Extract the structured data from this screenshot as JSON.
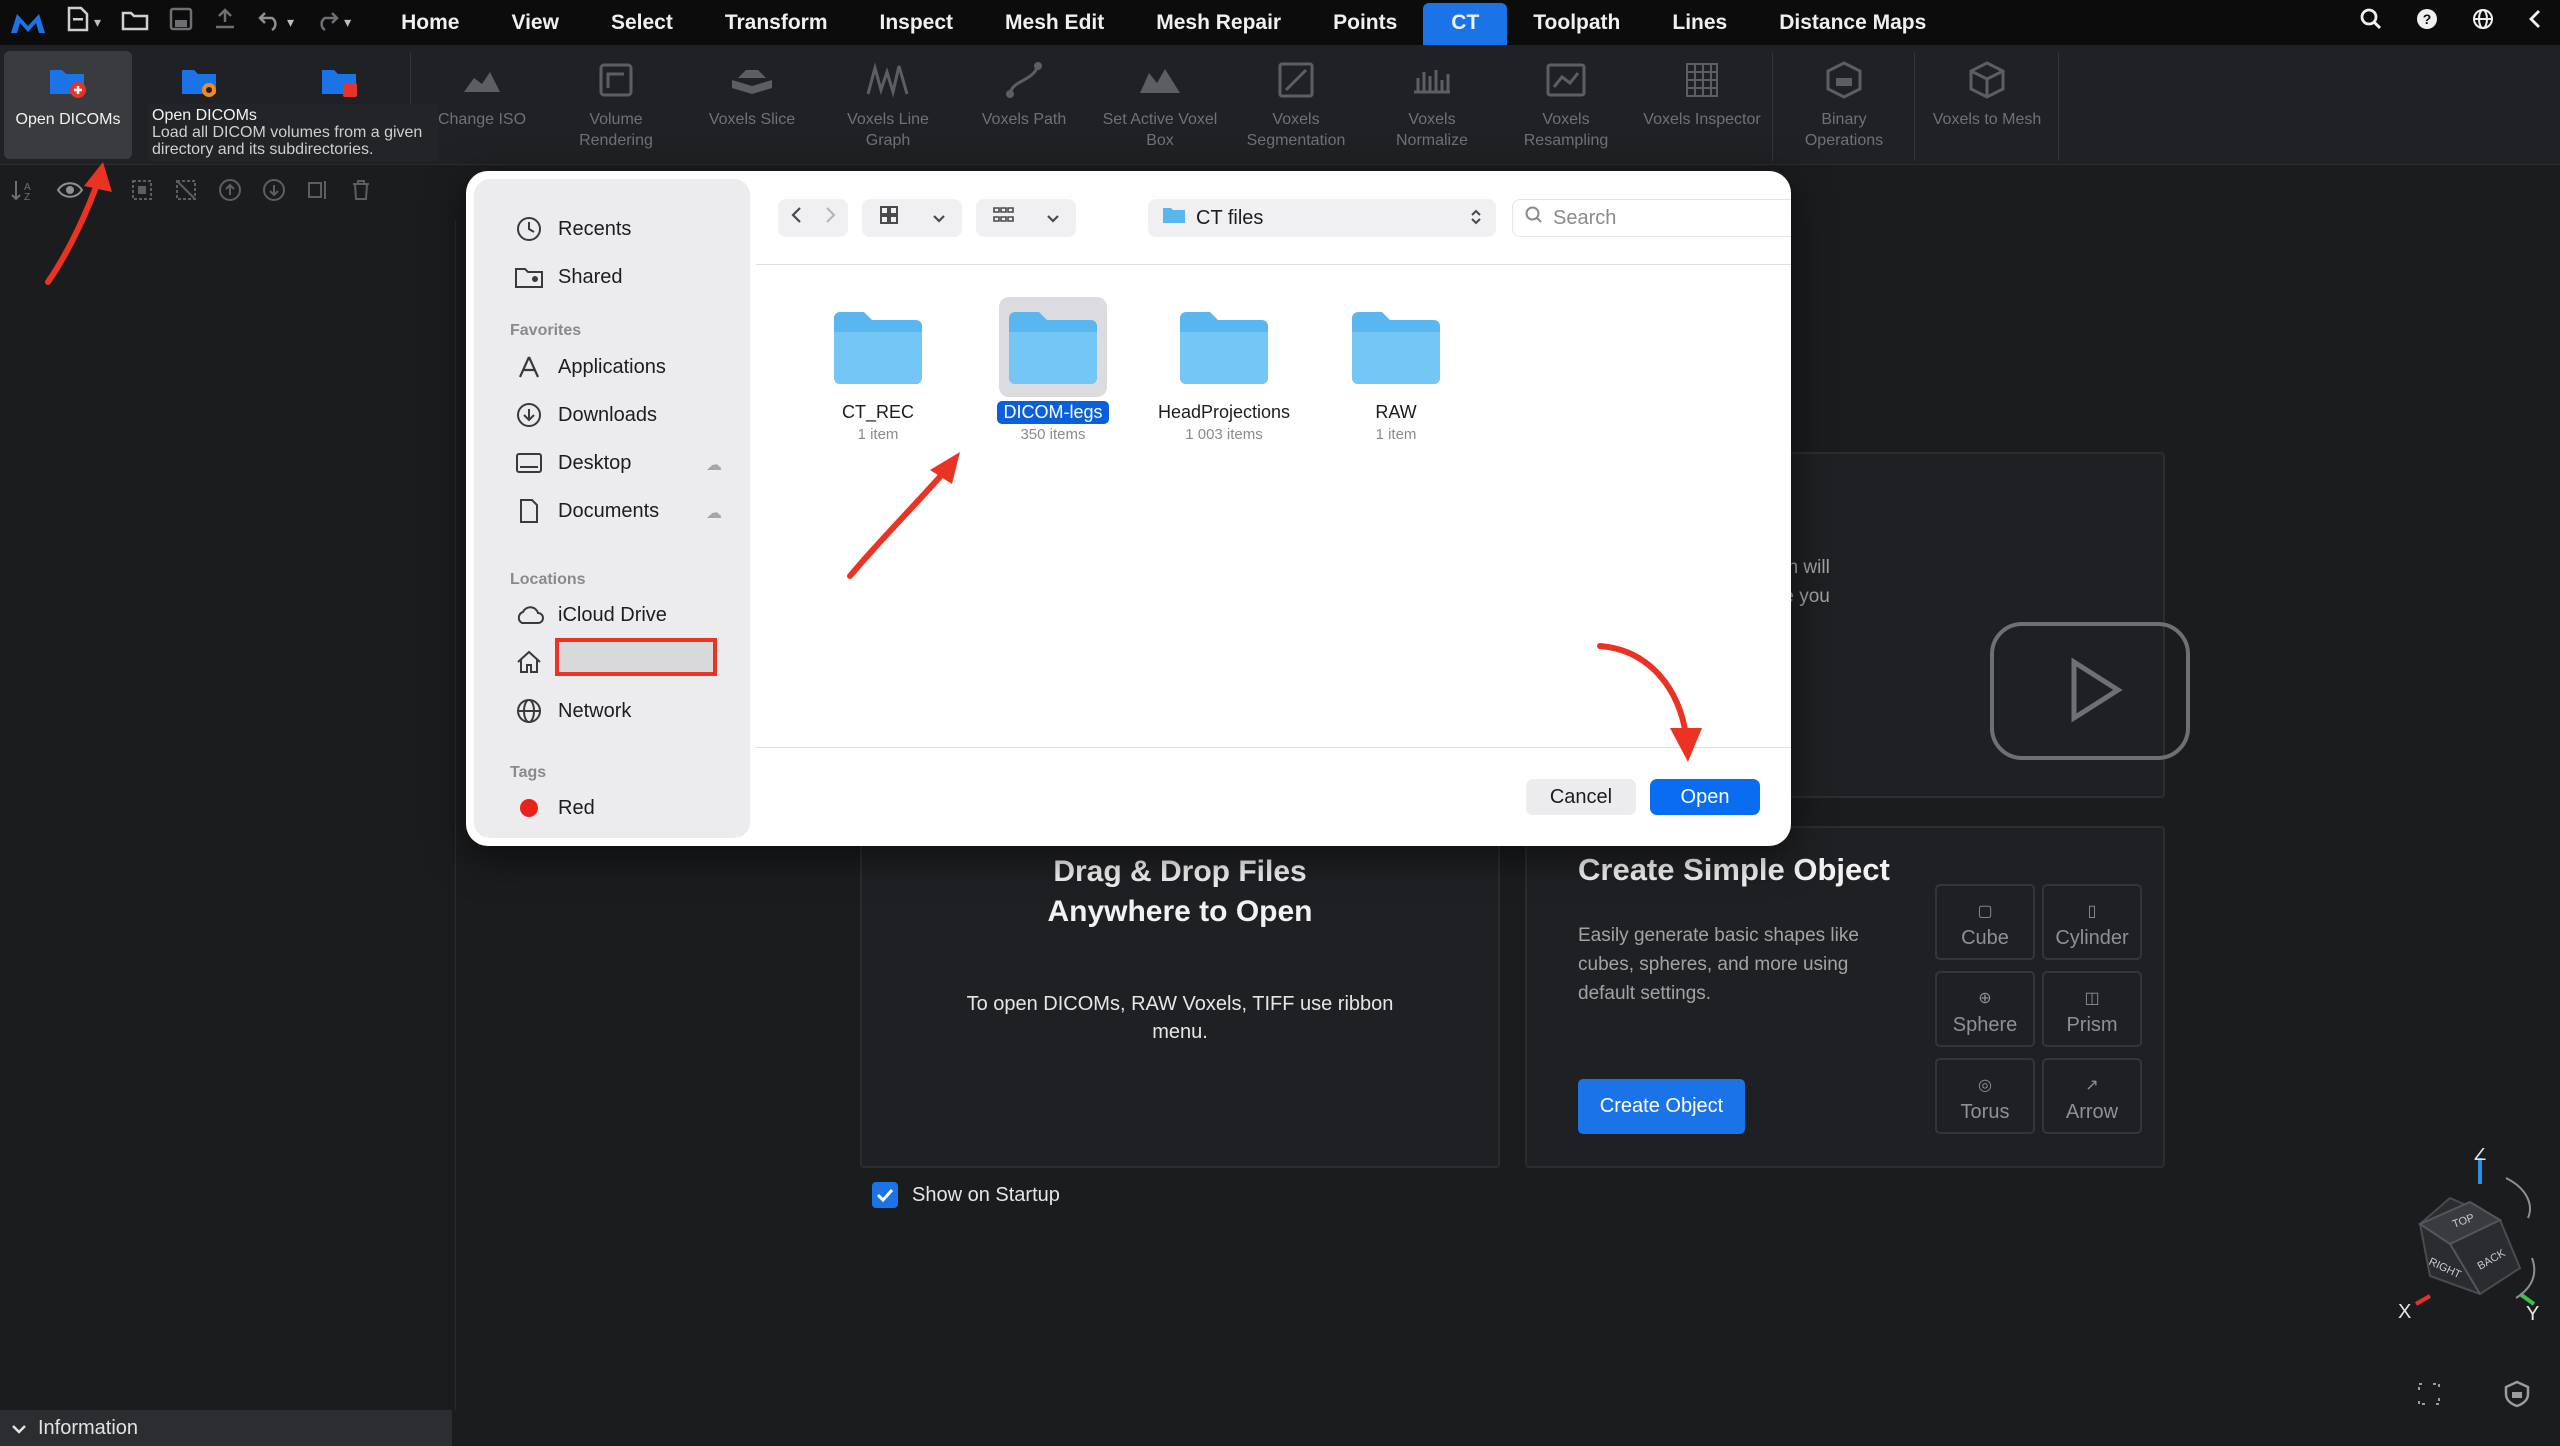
{
  "menubar": {
    "tabs": [
      "Home",
      "View",
      "Select",
      "Transform",
      "Inspect",
      "Mesh Edit",
      "Mesh Repair",
      "Points",
      "CT",
      "Toolpath",
      "Lines",
      "Distance Maps"
    ],
    "active_tab": "CT",
    "accent": "#1a74e8"
  },
  "ribbon": {
    "open_dicoms": "Open DICOMs",
    "change_iso": "Change ISO",
    "volume_rendering": "Volume Rendering",
    "voxels_slice": "Voxels Slice",
    "voxels_line_graph": "Voxels Line Graph",
    "voxels_path": "Voxels Path",
    "set_active_voxel_box": "Set Active Voxel Box",
    "voxels_segmentation": "Voxels Segmentation",
    "voxels_normalize": "Voxels Normalize",
    "voxels_resampling": "Voxels Resampling",
    "voxels_inspector": "Voxels Inspector",
    "binary_operations": "Binary Operations",
    "voxels_to_mesh": "Voxels to Mesh"
  },
  "tooltip": {
    "title": "Open DICOMs",
    "body": "Load all DICOM volumes from a given directory and its subdirectories."
  },
  "left_panel": {
    "information": "Information"
  },
  "start_page": {
    "video_text_1": "ction will",
    "video_text_2": "uide you",
    "dnd_title_1": "Drag & Drop Files",
    "dnd_title_2": "Anywhere to Open",
    "dnd_sub": "To open DICOMs, RAW Voxels, TIFF use ribbon menu.",
    "simple_title": "Create Simple Object",
    "simple_desc": "Easily generate basic shapes like cubes, spheres, and more using default settings.",
    "create_button": "Create Object",
    "shapes": [
      "Cube",
      "Cylinder",
      "Sphere",
      "Prism",
      "Torus",
      "Arrow"
    ],
    "show_on_startup": "Show on Startup",
    "show_on_startup_checked": true
  },
  "viewcube": {
    "axes": {
      "z": "Z",
      "x": "X",
      "y": "Y"
    },
    "faces": {
      "top": "TOP",
      "right": "RIGHT",
      "back": "BACK"
    }
  },
  "dialog": {
    "sidebar": {
      "recents": "Recents",
      "shared": "Shared",
      "favorites_header": "Favorites",
      "applications": "Applications",
      "downloads": "Downloads",
      "desktop": "Desktop",
      "documents": "Documents",
      "locations_header": "Locations",
      "icloud": "iCloud Drive",
      "network": "Network",
      "tags_header": "Tags",
      "tag_red": "Red",
      "tag_red_color": "#e8241a"
    },
    "path": "CT files",
    "search_placeholder": "Search",
    "folders": [
      {
        "name": "CT_REC",
        "count": "1 item",
        "selected": false
      },
      {
        "name": "DICOM-legs",
        "count": "350 items",
        "selected": true
      },
      {
        "name": "HeadProjections",
        "count": "1 003 items",
        "selected": false
      },
      {
        "name": "RAW",
        "count": "1 item",
        "selected": false
      }
    ],
    "cancel": "Cancel",
    "open": "Open",
    "open_color": "#0a6cf0",
    "folder_color": "#5ab6ef"
  },
  "annotations": {
    "arrow_color": "#ea3323",
    "highlight_color": "#ea3323"
  }
}
